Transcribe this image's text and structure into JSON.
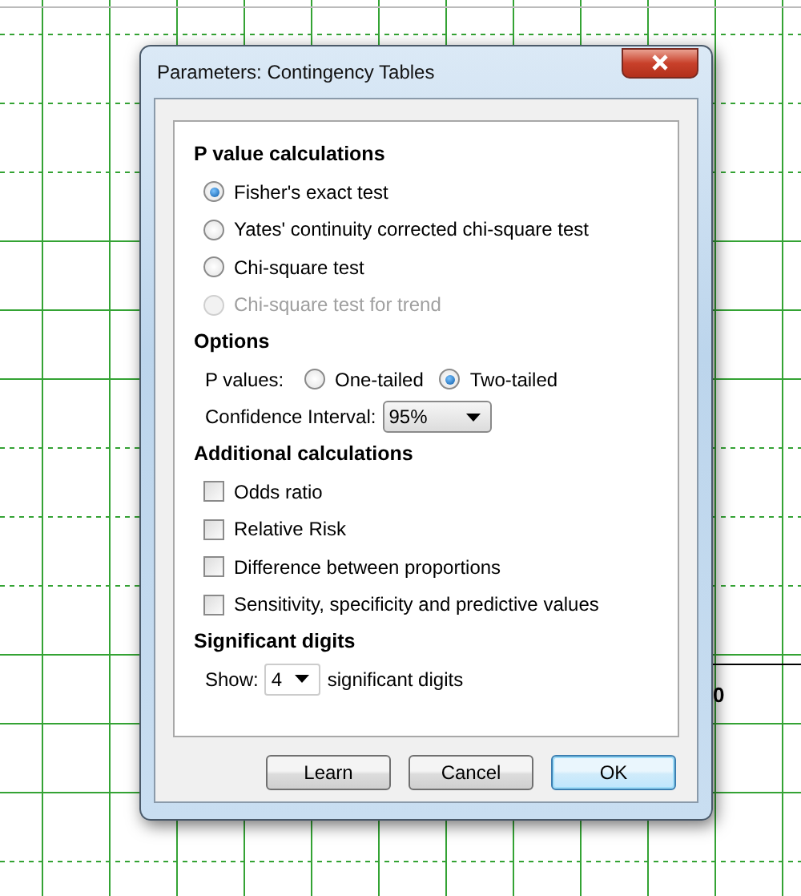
{
  "window": {
    "title": "Parameters: Contingency Tables"
  },
  "p_value_calculations": {
    "heading": "P value calculations",
    "options": [
      {
        "label": "Fisher's exact test",
        "selected": true,
        "disabled": false
      },
      {
        "label": "Yates' continuity corrected chi-square test",
        "selected": false,
        "disabled": false
      },
      {
        "label": "Chi-square test",
        "selected": false,
        "disabled": false
      },
      {
        "label": "Chi-square test for trend",
        "selected": false,
        "disabled": true
      }
    ]
  },
  "options": {
    "heading": "Options",
    "p_values": {
      "label": "P values:",
      "choices": [
        {
          "label": "One-tailed",
          "selected": false
        },
        {
          "label": "Two-tailed",
          "selected": true
        }
      ]
    },
    "confidence_interval": {
      "label": "Confidence Interval:",
      "value": "95%"
    }
  },
  "additional_calculations": {
    "heading": "Additional calculations",
    "items": [
      {
        "label": "Odds ratio",
        "checked": false
      },
      {
        "label": "Relative Risk",
        "checked": false
      },
      {
        "label": "Difference between proportions",
        "checked": false
      },
      {
        "label": "Sensitivity, specificity and predictive values",
        "checked": false
      }
    ]
  },
  "significant_digits": {
    "heading": "Significant digits",
    "label": "Show:",
    "value": "4",
    "suffix": "significant digits"
  },
  "buttons": [
    {
      "label": "Learn",
      "default": false
    },
    {
      "label": "Cancel",
      "default": false
    },
    {
      "label": "OK",
      "default": true
    }
  ],
  "sheet": {
    "cell_text": "0"
  }
}
